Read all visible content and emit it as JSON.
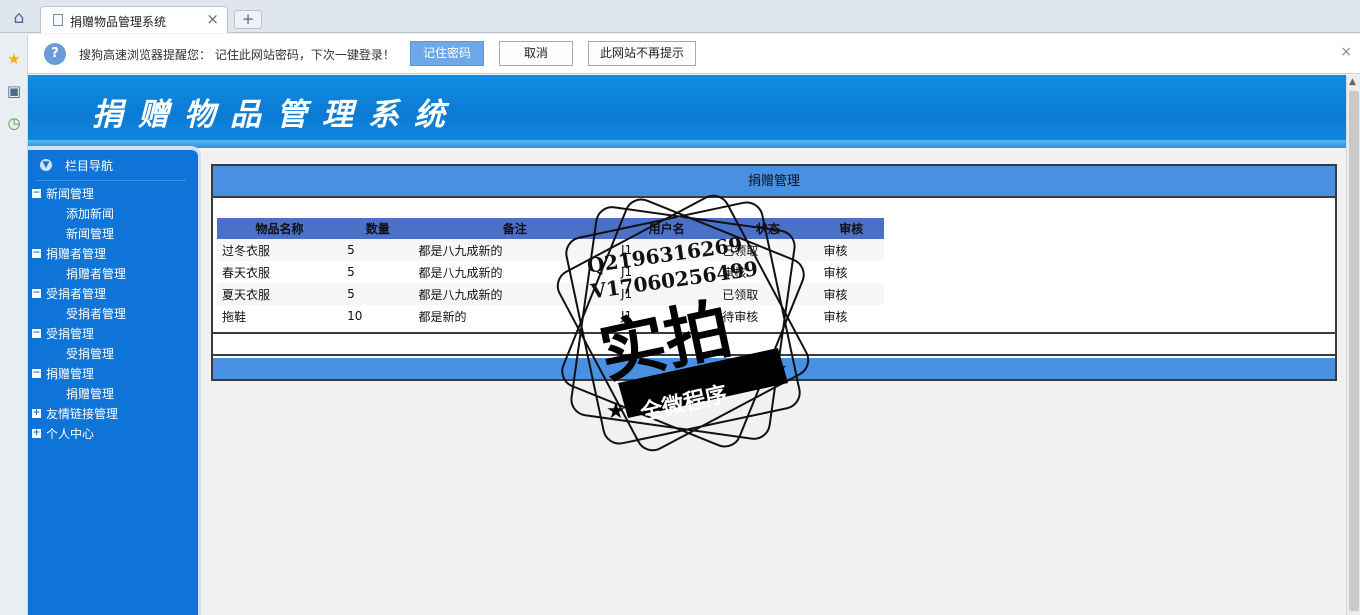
{
  "browser": {
    "tab_title": "捐赠物品管理系统",
    "tab_close": "×",
    "new_tab": "+",
    "home_icon": "house-icon"
  },
  "notify": {
    "message": "搜狗高速浏览器提醒您： 记住此网站密码，下次一键登录！",
    "remember_label": "记住密码",
    "cancel_label": "取消",
    "never_label": "此网站不再提示",
    "close": "×"
  },
  "site": {
    "title": "捐赠物品管理系统"
  },
  "nav": {
    "title": "栏目导航",
    "items": [
      {
        "label": "新闻管理",
        "type": "group",
        "toggle": "−"
      },
      {
        "label": "添加新闻",
        "type": "child"
      },
      {
        "label": "新闻管理",
        "type": "child"
      },
      {
        "label": "捐赠者管理",
        "type": "group",
        "toggle": "−"
      },
      {
        "label": "捐赠者管理",
        "type": "child"
      },
      {
        "label": "受捐者管理",
        "type": "group",
        "toggle": "−"
      },
      {
        "label": "受捐者管理",
        "type": "child"
      },
      {
        "label": "受捐管理",
        "type": "group",
        "toggle": "−"
      },
      {
        "label": "受捐管理",
        "type": "child"
      },
      {
        "label": "捐赠管理",
        "type": "group",
        "toggle": "−"
      },
      {
        "label": "捐赠管理",
        "type": "child"
      },
      {
        "label": "友情链接管理",
        "type": "group",
        "toggle": "+"
      },
      {
        "label": "个人中心",
        "type": "group",
        "toggle": "+"
      }
    ]
  },
  "main": {
    "title": "捐赠管理",
    "table": {
      "headers": [
        "物品名称",
        "数量",
        "备注",
        "用户名",
        "状态",
        "审核"
      ],
      "rows": [
        [
          "过冬衣服",
          "5",
          "都是八九成新的",
          "J1",
          "已领取",
          "审核"
        ],
        [
          "春天衣服",
          "5",
          "都是八九成新的",
          "J1",
          "审核",
          "审核"
        ],
        [
          "夏天衣服",
          "5",
          "都是八九成新的",
          "J1",
          "已领取",
          "审核"
        ],
        [
          "拖鞋",
          "10",
          "都是新的",
          "J1",
          "待审核",
          "审核"
        ]
      ]
    }
  },
  "watermark": {
    "line1": "Q2196316269",
    "line2": "V17060256499",
    "big": "实拍",
    "ribbon": "全微程序"
  },
  "colors": {
    "banner": "#0c7ad3",
    "nav": "#0e74d8",
    "panel_header": "#4a90e2",
    "table_header": "#4a70c8"
  }
}
